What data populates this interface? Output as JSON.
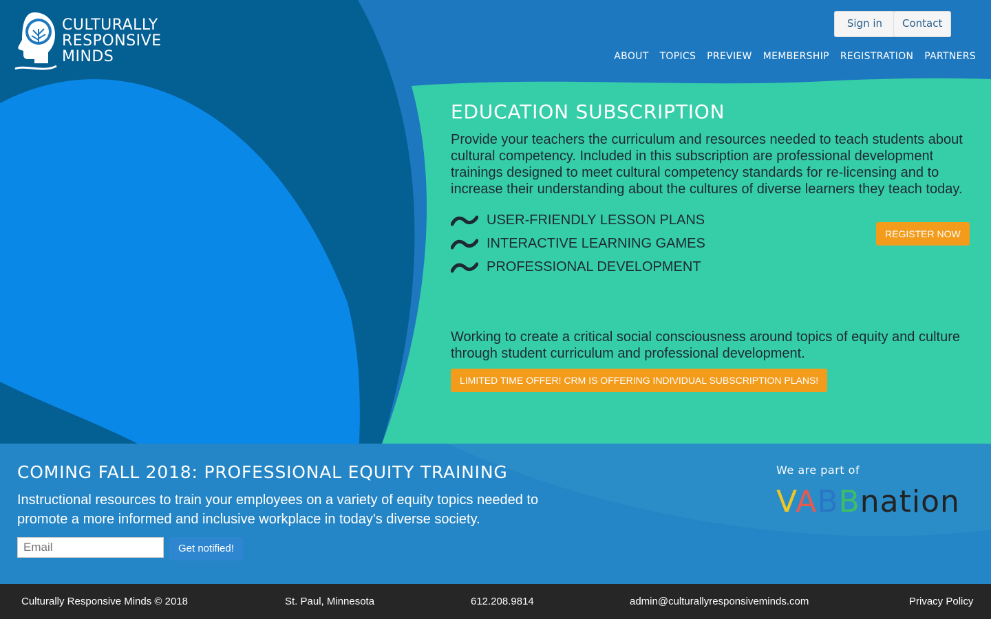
{
  "brand": {
    "logo_lines": [
      "CULTURALLY",
      "RESPONSIVE",
      "MINDS"
    ]
  },
  "header": {
    "signin_label": "Sign in",
    "contact_label": "Contact",
    "nav": [
      "ABOUT",
      "TOPICS",
      "PREVIEW",
      "MEMBERSHIP",
      "REGISTRATION",
      "PARTNERS"
    ]
  },
  "education": {
    "title": "EDUCATION SUBSCRIPTION",
    "description": "Provide your teachers the curriculum and resources needed to teach students about cultural competency. Included in this subscription are professional development trainings designed to meet cultural competency standards for re-licensing and to increase their understanding about the cultures of diverse learners they teach today.",
    "features": [
      "USER-FRIENDLY LESSON PLANS",
      "INTERACTIVE LEARNING GAMES",
      "PROFESSIONAL DEVELOPMENT"
    ],
    "register_label": "REGISTER NOW",
    "mission": "Working to create a critical social consciousness around topics of equity and culture through student curriculum and professional development.",
    "offer_label": "LIMITED TIME OFFER! CRM IS OFFERING INDIVIDUAL SUBSCRIPTION PLANS!"
  },
  "coming": {
    "title": "COMING FALL 2018: PROFESSIONAL EQUITY TRAINING",
    "text": "Instructional resources to train your employees on a variety of equity topics needed to promote a more informed and inclusive workplace in today's diverse society.",
    "email_placeholder": "Email",
    "notify_label": "Get notified!"
  },
  "partner": {
    "label": "We are part of",
    "logo_letters": [
      "V",
      "A",
      "B",
      "B"
    ],
    "logo_rest": "nation"
  },
  "footer": {
    "copyright": "Culturally Responsive Minds © 2018",
    "location": "St. Paul, Minnesota",
    "phone": "612.208.9814",
    "email": "admin@culturallyresponsiveminds.com",
    "privacy": "Privacy Policy"
  },
  "colors": {
    "accent_orange": "#f39b1b",
    "green_panel": "#36cea8",
    "dark_blue": "#045f93",
    "bright_blue": "#0a88e8"
  }
}
